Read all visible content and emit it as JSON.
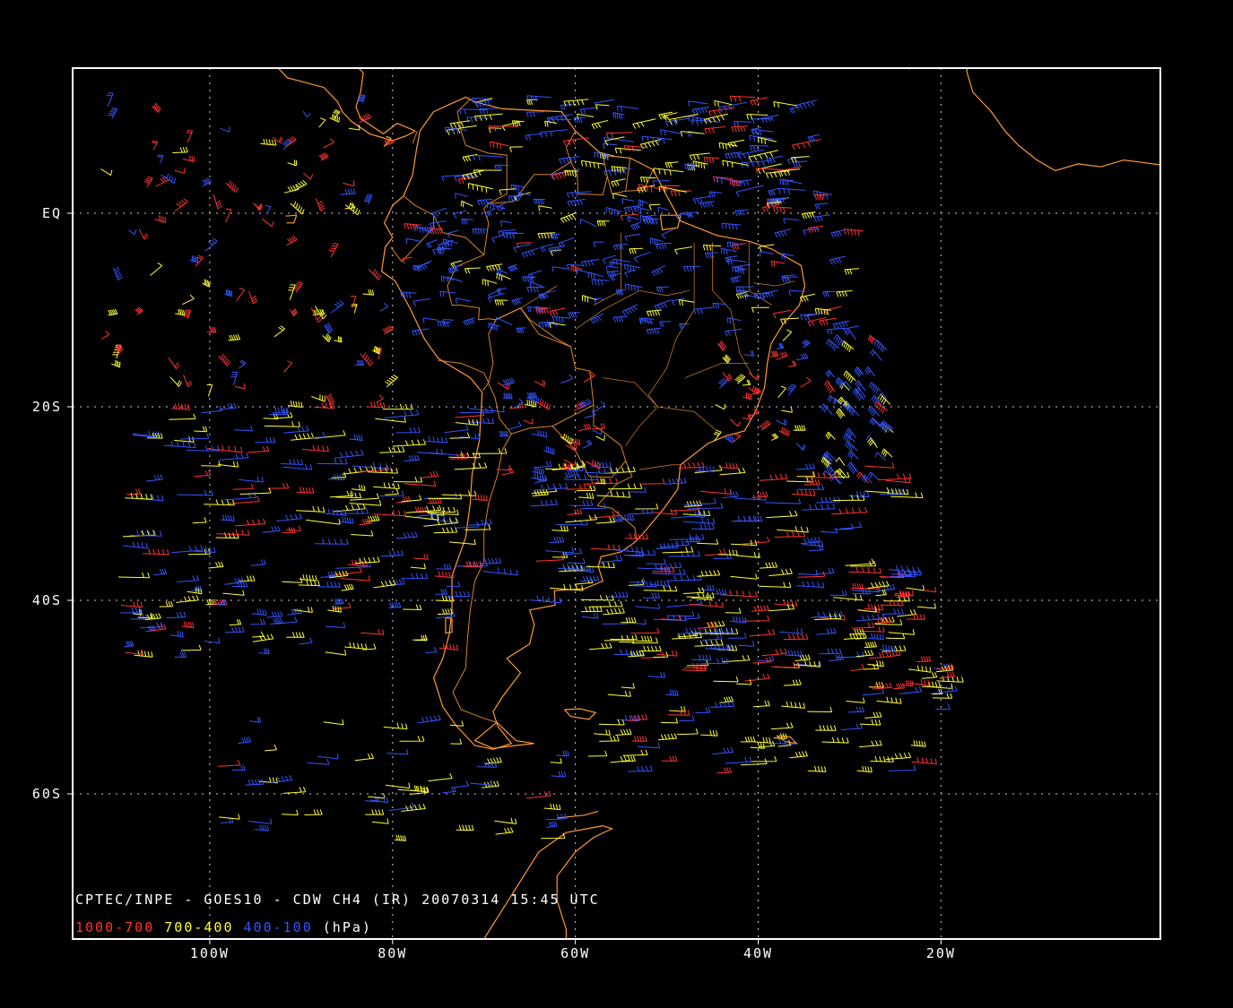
{
  "map": {
    "lat_range": [
      -75,
      15
    ],
    "lon_range": [
      -115,
      4
    ],
    "grid_lons": [
      -100,
      -80,
      -60,
      -40,
      -20
    ],
    "grid_lats": [
      0,
      -20,
      -40,
      -60
    ],
    "lon_labels": [
      "100W",
      "80W",
      "60W",
      "40W",
      "20W"
    ],
    "lat_labels": [
      "EQ",
      "20S",
      "40S",
      "60S"
    ],
    "frame_color": "#ffffff",
    "coast_color": "#ff9933",
    "grid_color": "#cccccc",
    "background": "#000000"
  },
  "caption": {
    "line1": "CPTEC/INPE - GOES10 - CDW CH4 (IR) 20070314 15:45 UTC",
    "legend": [
      {
        "text": "1000-700",
        "color": "#ff3333"
      },
      {
        "text": "700-400",
        "color": "#ffff33"
      },
      {
        "text": "400-100",
        "color": "#3355ff"
      },
      {
        "text": "(hPa)",
        "color": "#ffffff"
      }
    ]
  },
  "wind_layers": [
    {
      "name": "1000-700",
      "color": "#ff3333"
    },
    {
      "name": "700-400",
      "color": "#ffff33"
    },
    {
      "name": "400-100",
      "color": "#3355ff"
    }
  ]
}
